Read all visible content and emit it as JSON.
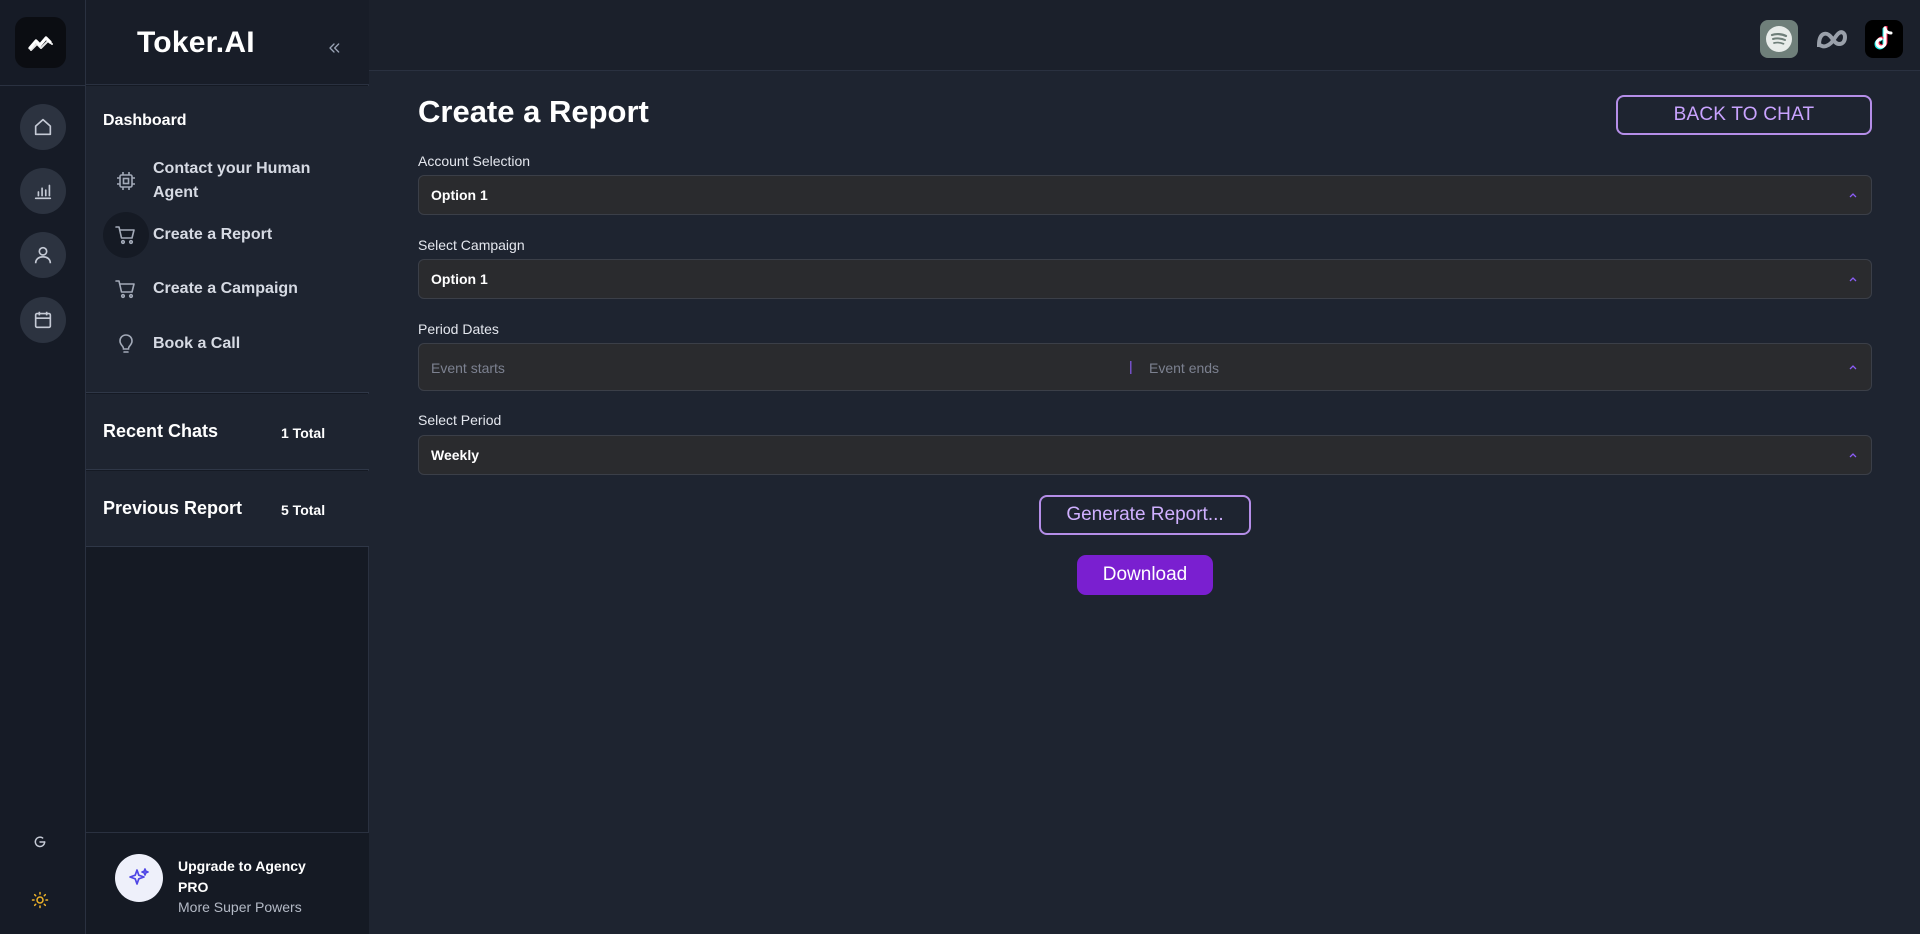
{
  "app": {
    "brand": "Toker.AI"
  },
  "rail": {
    "icons": [
      "logo-icon",
      "home-icon",
      "chart-icon",
      "user-icon",
      "calendar-icon",
      "refresh-icon",
      "sun-icon"
    ]
  },
  "sidebar": {
    "menu_title": "Dashboard",
    "items": [
      {
        "label": "Contact your Human Agent",
        "icon": "chip-icon"
      },
      {
        "label": "Create a Report",
        "icon": "cart-icon",
        "active": true
      },
      {
        "label": "Create a Campaign",
        "icon": "cart-icon"
      },
      {
        "label": "Book a Call",
        "icon": "bulb-icon"
      }
    ],
    "recent_chats": {
      "title": "Recent Chats",
      "count": "1 Total"
    },
    "previous_report": {
      "title": "Previous Report",
      "count": "5 Total"
    },
    "upgrade": {
      "title": "Upgrade to Agency PRO",
      "subtitle": "More Super Powers",
      "icon": "sparkle-icon"
    }
  },
  "topbar": {
    "integrations": [
      "spotify-icon",
      "meta-icon",
      "tiktok-icon"
    ]
  },
  "main": {
    "title": "Create a Report",
    "back_button": "BACK TO CHAT",
    "account_selection": {
      "label": "Account Selection",
      "value": "Option 1"
    },
    "select_campaign": {
      "label": "Select Campaign",
      "value": "Option 1"
    },
    "period_dates": {
      "label": "Period Dates",
      "start_placeholder": "Event starts",
      "separator": "|",
      "end_placeholder": "Event ends"
    },
    "select_period": {
      "label": "Select Period",
      "value": "Weekly"
    },
    "generate_button": "Generate Report...",
    "download_button": "Download"
  },
  "colors": {
    "accent": "#7a1fd0",
    "accent_border": "#b58ee8",
    "background": "#1e2430"
  }
}
